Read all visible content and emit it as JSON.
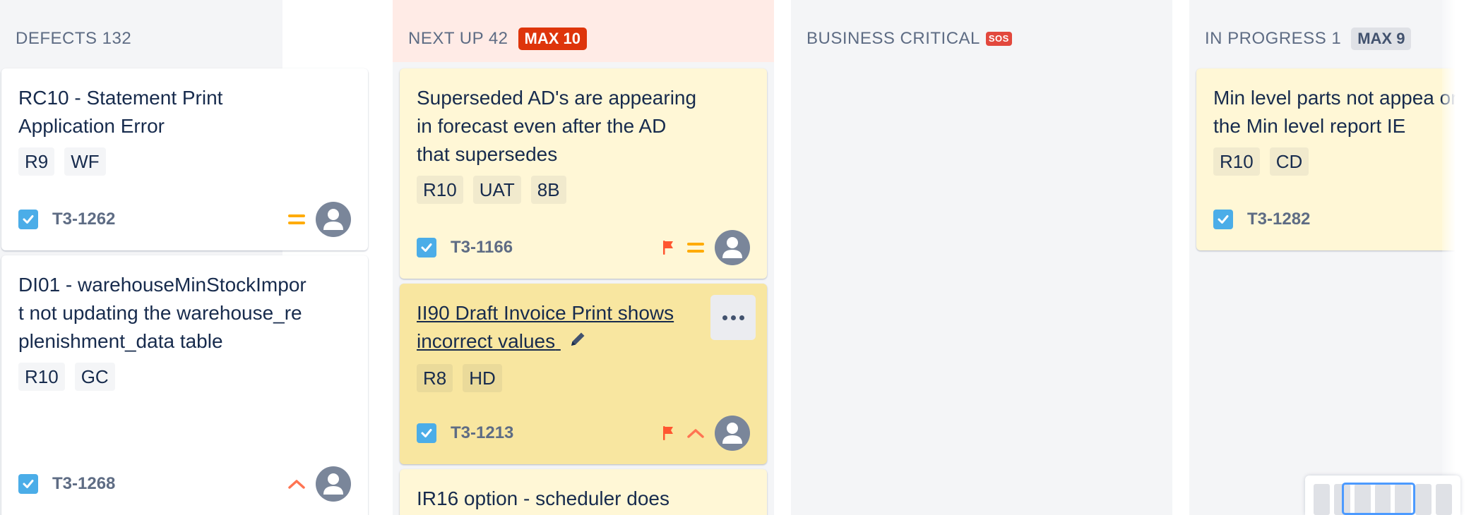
{
  "columns": [
    {
      "title": "DEFECTS 132",
      "max": ""
    },
    {
      "title": "NEXT UP 42",
      "max": "MAX 10"
    },
    {
      "title": "BUSINESS CRITICAL",
      "emoji": "SOS",
      "max": ""
    },
    {
      "title": "IN PROGRESS 1",
      "max": "MAX 9"
    }
  ],
  "cards": {
    "c1": {
      "summary": "RC10 - Statement Print Application Error",
      "labels": [
        "R9",
        "WF"
      ],
      "key": "T3-1262",
      "priority": "medium"
    },
    "c2": {
      "summary": "DI01 - warehouseMinStockImport not updating the warehouse_replenishment_data table",
      "labels": [
        "R10",
        "GC"
      ],
      "key": "T3-1268",
      "priority": "high"
    },
    "c3": {
      "summary": "Superseded AD's are appearing in forecast even after the AD that supersedes",
      "labels": [
        "R10",
        "UAT",
        "8B"
      ],
      "key": "T3-1166",
      "priority": "medium",
      "flagged": true
    },
    "c4": {
      "summary": "II90 Draft Invoice Print shows incorrect values",
      "labels": [
        "R8",
        "HD"
      ],
      "key": "T3-1213",
      "priority": "high",
      "flagged": true
    },
    "c5": {
      "summary": "IR16 option - scheduler does"
    },
    "c6": {
      "summary": "Min level parts not appea on the Min level report IE",
      "labels": [
        "R10",
        "CD"
      ],
      "key": "T3-1282"
    }
  },
  "colors": {
    "accent": "#0052cc",
    "issue_type": "#4bade8",
    "flag": "#ff5630",
    "priority_high": "#ff7452",
    "priority_medium": "#ffab00",
    "max_badge": "#de350b"
  }
}
